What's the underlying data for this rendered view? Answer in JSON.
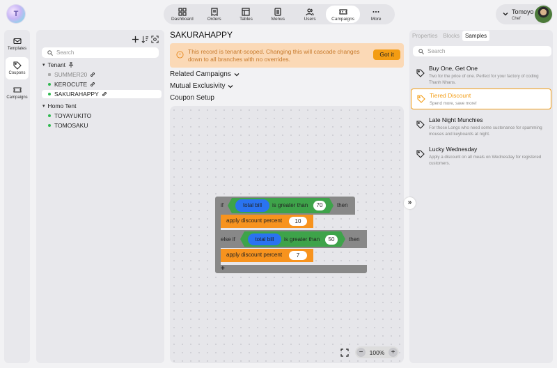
{
  "app": {
    "logo_text": "T"
  },
  "nav": {
    "items": [
      {
        "label": "Dashboard",
        "icon": "dashboard-icon"
      },
      {
        "label": "Orders",
        "icon": "orders-icon"
      },
      {
        "label": "Tables",
        "icon": "tables-icon"
      },
      {
        "label": "Menus",
        "icon": "menus-icon"
      },
      {
        "label": "Users",
        "icon": "users-icon"
      },
      {
        "label": "Campaigns",
        "icon": "campaigns-icon",
        "active": true
      },
      {
        "label": "More",
        "icon": "more-icon"
      }
    ]
  },
  "user": {
    "name": "Tomoyo",
    "role": "Chef"
  },
  "leftbar": {
    "items": [
      {
        "label": "Templates",
        "icon": "mail-icon"
      },
      {
        "label": "Coupons",
        "icon": "tag-icon",
        "active": true
      },
      {
        "label": "Campaigns",
        "icon": "ticket-icon"
      }
    ]
  },
  "tree": {
    "search_placeholder": "Search",
    "groups": [
      {
        "label": "Tenant",
        "pinned": true,
        "children": [
          {
            "label": "SUMMER20",
            "status": "inactive",
            "linked": true
          },
          {
            "label": "KEROCUTE",
            "status": "active",
            "linked": true
          },
          {
            "label": "SAKURAHAPPY",
            "status": "active",
            "linked": true,
            "selected": true
          }
        ]
      },
      {
        "label": "Homo Tent",
        "children": [
          {
            "label": "TOYAYUKITO",
            "status": "active"
          },
          {
            "label": "TOMOSAKU",
            "status": "active"
          }
        ]
      }
    ]
  },
  "main": {
    "title": "SAKURAHAPPY",
    "alert": {
      "text": "This record is tenant-scoped. Changing this will cascade changes down to all branches with no overrides.",
      "button": "Got it"
    },
    "sections": [
      "Related Campaigns",
      "Mutual Exclusivity",
      "Coupon Setup"
    ],
    "blocks": {
      "if": "if",
      "then": "then",
      "else_if": "else if",
      "total_bill": "total bill",
      "greater": "is greater than",
      "threshold1": "70",
      "threshold2": "50",
      "action": "apply discount percent",
      "discount1": "10",
      "discount2": "7",
      "add": "+"
    },
    "zoom": {
      "minus": "−",
      "value": "100%",
      "plus": "+"
    },
    "collapse_glyph": "»"
  },
  "right": {
    "tabs": [
      "Properties",
      "Blocks",
      "Samples"
    ],
    "active_tab": "Samples",
    "search_placeholder": "Search",
    "cards": [
      {
        "title": "Buy One, Get One",
        "desc": "Two for the price of one. Perfect for your factory of coding Thanh Nhans."
      },
      {
        "title": "Tiered Discount",
        "desc": "Spend more, save more!",
        "selected": true
      },
      {
        "title": "Late Night Munchies",
        "desc": "For those Longs who need some sustenance for spamming mouses and keyboards at night."
      },
      {
        "title": "Lucky Wednesday",
        "desc": "Apply a discount on all meals on Wednesday for registered customers."
      }
    ]
  },
  "colors": {
    "accent": "#f39c12",
    "alert_bg": "#fbd9b6",
    "active_dot": "#2fb94f",
    "block_grey": "#888888",
    "block_orange": "#f7931e",
    "block_green": "#3ea34a",
    "block_blue": "#2a73f0"
  }
}
